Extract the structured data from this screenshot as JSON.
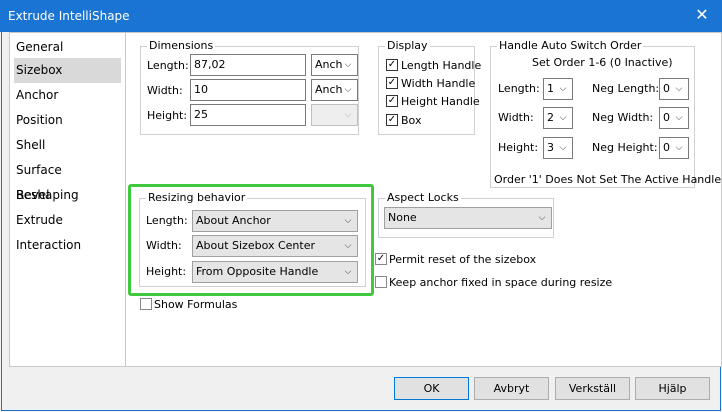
{
  "window": {
    "title": "Extrude IntelliShape",
    "close_glyph": "✕"
  },
  "sidebar": {
    "items": [
      {
        "label": "General"
      },
      {
        "label": "Sizebox"
      },
      {
        "label": "Anchor"
      },
      {
        "label": "Position"
      },
      {
        "label": "Shell"
      },
      {
        "label": "Surface Reshaping"
      },
      {
        "label": "Bevel"
      },
      {
        "label": "Extrude"
      },
      {
        "label": "Interaction"
      }
    ],
    "selected": "Sizebox"
  },
  "dimensions": {
    "title": "Dimensions",
    "length_label": "Length:",
    "length_value": "87,02",
    "length_unit": "Anch",
    "width_label": "Width:",
    "width_value": "10",
    "width_unit": "Anch",
    "height_label": "Height:",
    "height_value": "25",
    "height_unit": ""
  },
  "display": {
    "title": "Display",
    "length_handle": "Length Handle",
    "width_handle": "Width Handle",
    "height_handle": "Height Handle",
    "box": "Box"
  },
  "handle_order": {
    "title": "Handle Auto Switch Order",
    "subtitle": "Set Order 1-6  (0 Inactive)",
    "length_label": "Length:",
    "length_value": "1",
    "neg_length_label": "Neg Length:",
    "neg_length_value": "0",
    "width_label": "Width:",
    "width_value": "2",
    "neg_width_label": "Neg Width:",
    "neg_width_value": "0",
    "height_label": "Height:",
    "height_value": "3",
    "neg_height_label": "Neg Height:",
    "neg_height_value": "0",
    "note": "Order '1' Does Not Set The Active Handle"
  },
  "resizing": {
    "title": "Resizing behavior",
    "length_label": "Length:",
    "length_value": "About Anchor",
    "width_label": "Width:",
    "width_value": "About Sizebox Center",
    "height_label": "Height:",
    "height_value": "From Opposite Handle"
  },
  "aspect": {
    "title": "Aspect Locks",
    "value": "None"
  },
  "options": {
    "permit_reset": "Permit reset of the sizebox",
    "keep_anchor": "Keep anchor fixed in space during resize",
    "show_formulas": "Show Formulas"
  },
  "buttons": {
    "ok": "OK",
    "cancel": "Avbryt",
    "apply": "Verkställ",
    "help": "Hjälp"
  },
  "glyphs": {
    "check": "✓",
    "dropdown": "⌵"
  }
}
